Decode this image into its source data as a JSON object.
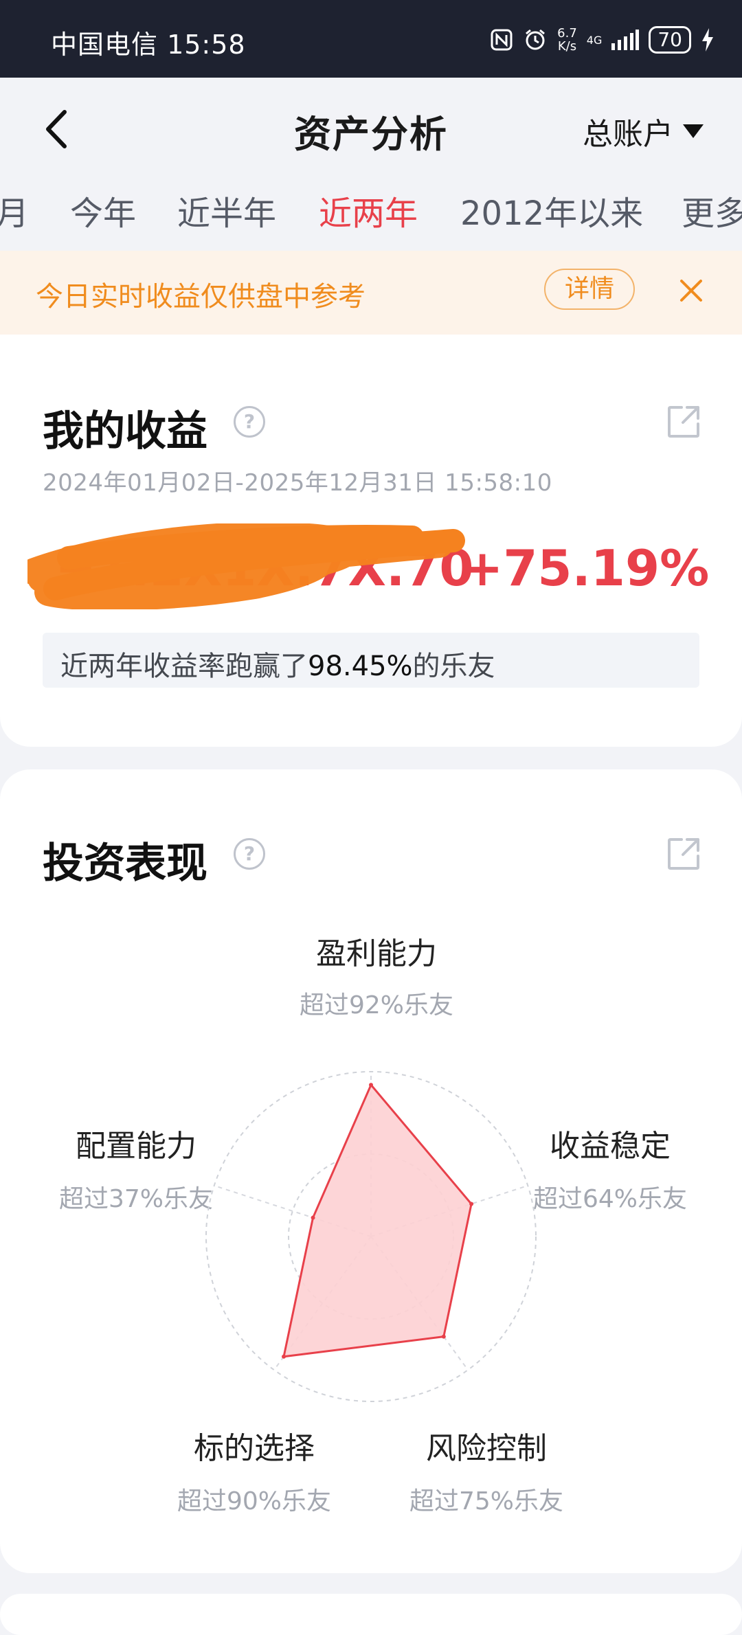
{
  "status_bar": {
    "carrier_time": "中国电信 15:58",
    "speed_value": "6.7",
    "speed_unit": "K/s",
    "network": "4G",
    "battery": "70"
  },
  "header": {
    "title": "资产分析",
    "account": "总账户"
  },
  "tabs": [
    "月",
    "今年",
    "近半年",
    "近两年",
    "2012年以来",
    "更多"
  ],
  "active_tab": "近两年",
  "notice": {
    "text": "今日实时收益仅供盘中参考",
    "detail_label": "详情"
  },
  "earnings": {
    "title": "我的收益",
    "date_range": "2024年01月02日-2025年12月31日 15:58:10",
    "amount_obscured": "+1.2X1X.7X.70",
    "return_rate": "+75.19%",
    "rank_prefix": "近两年收益率跑赢了",
    "rank_value": "98.45%",
    "rank_suffix": "的乐友"
  },
  "performance": {
    "title": "投资表现",
    "dimensions": [
      {
        "name": "盈利能力",
        "desc": "超过92%乐友",
        "score": 0.92
      },
      {
        "name": "收益稳定",
        "desc": "超过64%乐友",
        "score": 0.64
      },
      {
        "name": "风险控制",
        "desc": "超过75%乐友",
        "score": 0.75
      },
      {
        "name": "标的选择",
        "desc": "超过90%乐友",
        "score": 0.9
      },
      {
        "name": "配置能力",
        "desc": "超过37%乐友",
        "score": 0.37
      }
    ]
  },
  "colors": {
    "accent": "#e8404a",
    "notice": "#f08c1e",
    "radar_fill": "#fdd0d3",
    "scribble": "#f5821f"
  }
}
